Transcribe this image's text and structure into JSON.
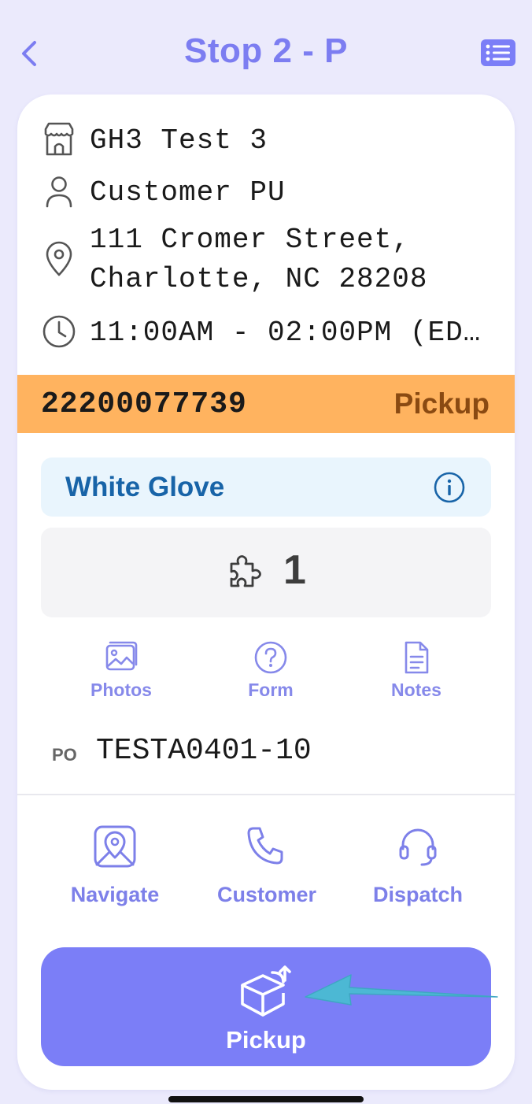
{
  "header": {
    "title": "Stop 2 - P"
  },
  "stop": {
    "location_name": "GH3 Test 3",
    "contact": "Customer PU",
    "address_line1": "111 Cromer Street,",
    "address_line2": "Charlotte, NC 28208",
    "time_window": "11:00AM - 02:00PM (ED…"
  },
  "order": {
    "number": "22200077739",
    "type": "Pickup"
  },
  "service": {
    "level": "White Glove"
  },
  "pieces": {
    "count": "1"
  },
  "actions_top": {
    "photos": "Photos",
    "form": "Form",
    "notes": "Notes"
  },
  "po": {
    "label": "PO",
    "value": "TESTA0401-10"
  },
  "actions_bottom": {
    "navigate": "Navigate",
    "customer": "Customer",
    "dispatch": "Dispatch"
  },
  "primary_action": {
    "label": "Pickup"
  },
  "colors": {
    "accent": "#7b7ef7",
    "order_bar": "#ffb35f",
    "order_type_text": "#8a4a12",
    "service_bg": "#e9f5fd",
    "service_text": "#1864a8",
    "annotation_arrow": "#4cb8d4"
  },
  "icons": {
    "back": "chevron-left-icon",
    "list": "list-icon",
    "store": "storefront-icon",
    "person": "person-icon",
    "location": "map-pin-icon",
    "clock": "clock-icon",
    "info": "info-icon",
    "pieces": "puzzle-piece-icon",
    "photos": "photos-icon",
    "form": "question-circle-icon",
    "notes": "document-icon",
    "navigate": "map-navigate-icon",
    "customer": "phone-icon",
    "dispatch": "headset-icon",
    "pickup": "box-upload-icon"
  }
}
